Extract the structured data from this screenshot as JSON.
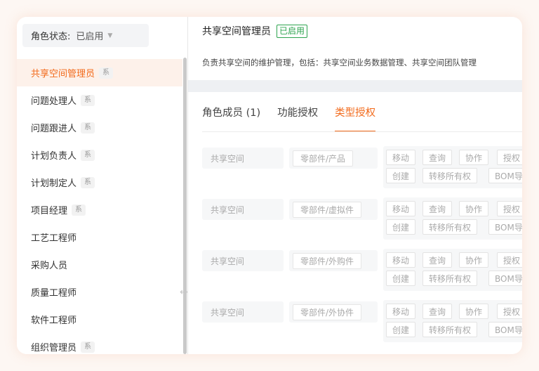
{
  "sidebar": {
    "filter": {
      "label": "角色状态:",
      "value": "已启用"
    },
    "items": [
      {
        "label": "共享空间管理员",
        "badge": "系",
        "active": true
      },
      {
        "label": "问题处理人",
        "badge": "系"
      },
      {
        "label": "问题跟进人",
        "badge": "系"
      },
      {
        "label": "计划负责人",
        "badge": "系"
      },
      {
        "label": "计划制定人",
        "badge": "系"
      },
      {
        "label": "项目经理",
        "badge": "系"
      },
      {
        "label": "工艺工程师",
        "badge": ""
      },
      {
        "label": "采购人员",
        "badge": ""
      },
      {
        "label": "质量工程师",
        "badge": ""
      },
      {
        "label": "软件工程师",
        "badge": ""
      },
      {
        "label": "组织管理员",
        "badge": "系"
      }
    ]
  },
  "main": {
    "title": "共享空间管理员",
    "status": "已启用",
    "description": "负责共享空间的维护管理，包括：共享空间业务数据管理、共享空间团队管理",
    "tabs": [
      {
        "label": "角色成员 (1)",
        "active": false
      },
      {
        "label": "功能授权",
        "active": false
      },
      {
        "label": "类型授权",
        "active": true
      }
    ],
    "rows": [
      {
        "space": "共享空间",
        "type": "零部件/产品",
        "perms_row1": [
          "移动",
          "查询",
          "协作",
          "授权"
        ],
        "perms_row2": [
          "创建",
          "转移所有权",
          "BOM导"
        ]
      },
      {
        "space": "共享空间",
        "type": "零部件/虚拟件",
        "perms_row1": [
          "移动",
          "查询",
          "协作",
          "授权"
        ],
        "perms_row2": [
          "创建",
          "转移所有权",
          "BOM导"
        ]
      },
      {
        "space": "共享空间",
        "type": "零部件/外购件",
        "perms_row1": [
          "移动",
          "查询",
          "协作",
          "授权"
        ],
        "perms_row2": [
          "创建",
          "转移所有权",
          "BOM导"
        ]
      },
      {
        "space": "共享空间",
        "type": "零部件/外协件",
        "perms_row1": [
          "移动",
          "查询",
          "协作",
          "授权"
        ],
        "perms_row2": [
          "创建",
          "转移所有权",
          "BOM导"
        ]
      }
    ]
  },
  "colors": {
    "accent": "#f26a1b",
    "status": "#2ea44f",
    "active_bg": "#fdf1ea"
  }
}
